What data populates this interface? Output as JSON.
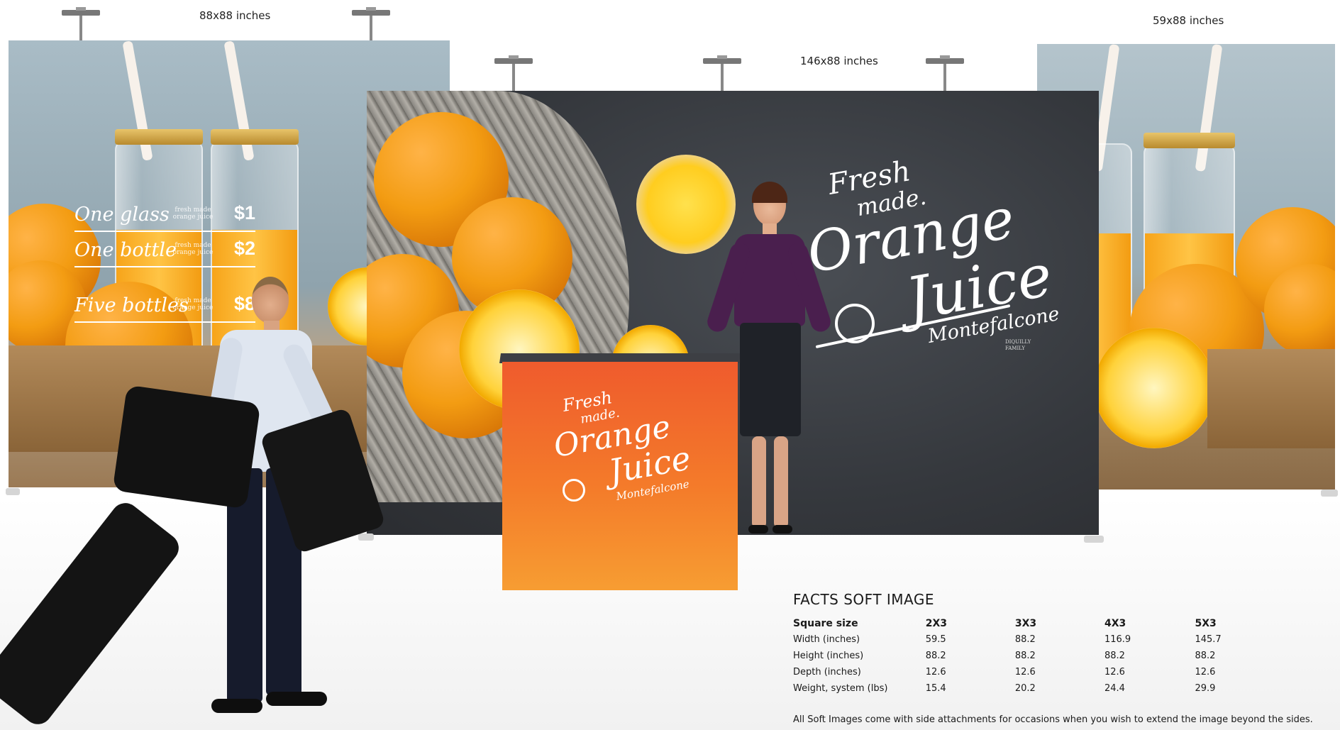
{
  "dimensions": {
    "left": "88x88 inches",
    "center": "146x88 inches",
    "right": "59x88 inches"
  },
  "left_panel": {
    "menu": [
      {
        "item": "One glass",
        "small": "fresh made orange juice",
        "price": "$1"
      },
      {
        "item": "One bottle",
        "small": "fresh made orange juice",
        "price": "$2"
      },
      {
        "item": "Five bottles",
        "small": "fresh made orange juice",
        "price": "$8"
      }
    ]
  },
  "center_panel": {
    "brand_line1": "Fresh",
    "brand_line2": "made.",
    "brand_line3": "Orange",
    "brand_line4": "Juice",
    "brand_name": "Montefalcone",
    "brand_sub": "DIQUILLY FAMILY"
  },
  "counter": {
    "brand_line1": "Fresh",
    "brand_line2": "made.",
    "brand_line3": "Orange",
    "brand_line4": "Juice",
    "brand_name": "Montefalcone"
  },
  "facts": {
    "title": "FACTS SOFT IMAGE",
    "header": {
      "label": "Square size",
      "values": [
        "2X3",
        "3X3",
        "4X3",
        "5X3"
      ]
    },
    "rows": [
      {
        "label": "Width (inches)",
        "values": [
          "59.5",
          "88.2",
          "116.9",
          "145.7"
        ]
      },
      {
        "label": "Height (inches)",
        "values": [
          "88.2",
          "88.2",
          "88.2",
          "88.2"
        ]
      },
      {
        "label": "Depth (inches)",
        "values": [
          "12.6",
          "12.6",
          "12.6",
          "12.6"
        ]
      },
      {
        "label": "Weight, system (lbs)",
        "values": [
          "15.4",
          "20.2",
          "24.4",
          "29.9"
        ]
      }
    ],
    "note": "All Soft Images come with side attachments for occasions when you wish to extend the image beyond the sides."
  },
  "colors": {
    "slate": "#3a3d42",
    "counter_orange": "#f06a2a",
    "marble": "#9fb3bd"
  }
}
